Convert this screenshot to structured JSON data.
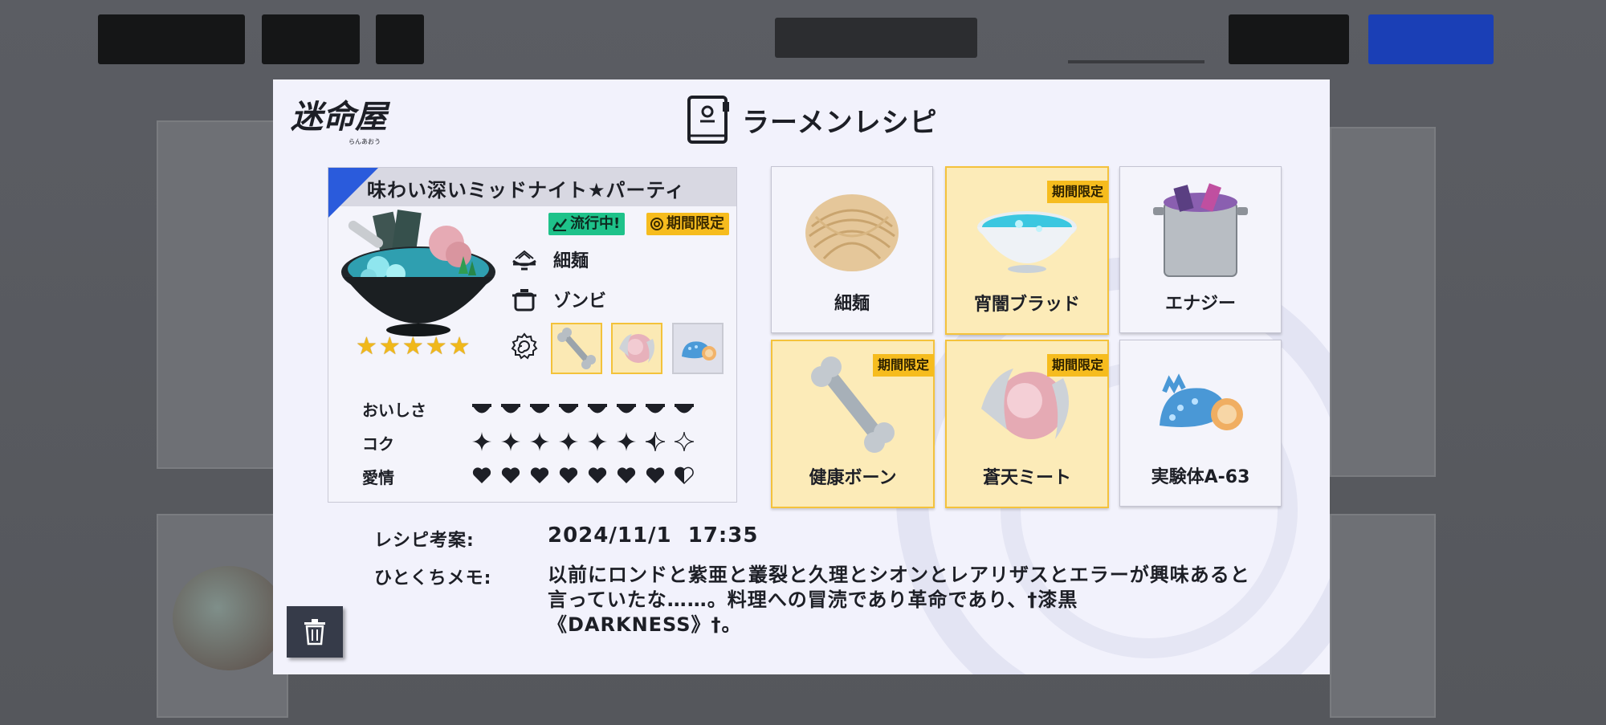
{
  "modal": {
    "logo_text": "迷命屋",
    "logo_subtext": "らんあおう",
    "header_title": "ラーメンレシピ"
  },
  "recipe": {
    "name": "味わい深いミッドナイト★パーティ",
    "badges": {
      "trending": "流行中!",
      "limited": "期間限定"
    },
    "noodle": "細麺",
    "soup": "ゾンビ",
    "rating_stars": 5,
    "stats": [
      {
        "label": "おいしさ",
        "icon": "bowl-icon",
        "value": 8,
        "max": 8
      },
      {
        "label": "コク",
        "icon": "sparkle-icon",
        "value": 6.5,
        "max": 8
      },
      {
        "label": "愛情",
        "icon": "heart-icon",
        "value": 7.5,
        "max": 8
      }
    ],
    "toppings": [
      {
        "icon": "bone-icon",
        "highlight": true
      },
      {
        "icon": "meat-icon",
        "highlight": true
      },
      {
        "icon": "creature-icon",
        "highlight": false
      }
    ]
  },
  "ingredients": [
    {
      "label": "細麺",
      "icon": "noodle-icon",
      "limited": false,
      "highlight": false
    },
    {
      "label": "宵闇ブラッド",
      "icon": "blood-soup-icon",
      "limited": true,
      "highlight": true
    },
    {
      "label": "エナジー",
      "icon": "pot-icon",
      "limited": false,
      "highlight": false
    },
    {
      "label": "健康ボーン",
      "icon": "bone-icon",
      "limited": true,
      "highlight": true
    },
    {
      "label": "蒼天ミート",
      "icon": "meat-icon",
      "limited": true,
      "highlight": true
    },
    {
      "label": "実験体A-63",
      "icon": "creature-icon",
      "limited": false,
      "highlight": false
    }
  ],
  "limited_tag": "期間限定",
  "info": {
    "date_label": "レシピ考案:",
    "date_value": "2024/11/1  17:35",
    "memo_label": "ひとくちメモ:",
    "memo_lines": [
      "以前にロンドと紫亜と叢裂と久理とシオンとレアリザスとエラーが興味あると",
      "言っていたな……。料理への冒涜であり革命であり、†漆黒",
      "《DARKNESS》†。"
    ]
  },
  "colors": {
    "accent_blue": "#2a5bdc",
    "limited_yellow": "#f6bc1e",
    "trend_green": "#1ec28a",
    "modal_bg": "#f2f2fc"
  }
}
